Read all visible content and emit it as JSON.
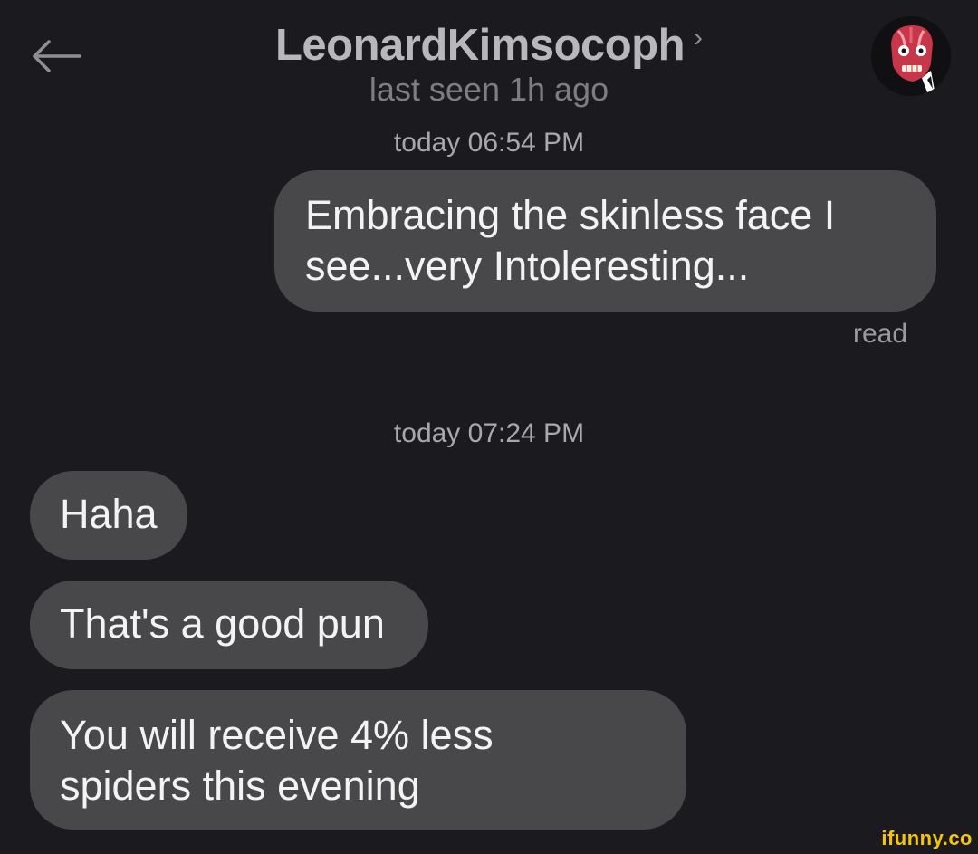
{
  "header": {
    "back_icon": "arrow-left-icon",
    "contact_name": "LeonardKimsocoph",
    "chevron": "›",
    "last_seen": "last seen 1h ago",
    "avatar_icon": "skinless-face-avatar"
  },
  "messages": [
    {
      "timestamp": "today 06:54 PM",
      "direction": "outgoing",
      "lines": [
        "Embracing the skinless face I",
        "see...very Intoleresting..."
      ],
      "status": "read"
    },
    {
      "timestamp": "today 07:24 PM",
      "direction": "incoming",
      "lines": [
        "Haha"
      ]
    },
    {
      "direction": "incoming",
      "lines": [
        "That's a good pun"
      ]
    },
    {
      "direction": "incoming",
      "lines": [
        "You will receive 4% less",
        "spiders this evening"
      ]
    }
  ],
  "watermark": "ifunny.co",
  "colors": {
    "background": "#1b1b1f",
    "bubble": "#48484b",
    "watermark": "#f5c40f"
  }
}
